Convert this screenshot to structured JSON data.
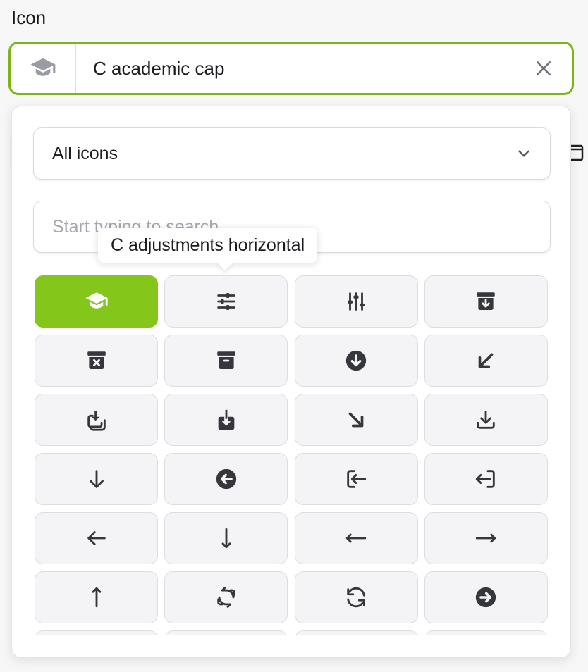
{
  "field": {
    "label": "Icon",
    "selected_value": "C academic cap",
    "selected_icon": "academic-cap-icon",
    "clear_icon": "close-icon"
  },
  "dropdown": {
    "category_select": {
      "value": "All icons",
      "icon": "chevron-down-icon"
    },
    "search": {
      "placeholder": "Start typing to search",
      "value": ""
    },
    "tooltip": "C adjustments horizontal"
  },
  "grid": {
    "selected_index": 0,
    "icons": [
      "academic-cap-icon",
      "adjustments-horizontal-icon",
      "adjustments-vertical-icon",
      "archive-box-arrow-down-icon",
      "archive-box-x-mark-icon",
      "archive-box-icon",
      "arrow-down-circle-icon",
      "arrow-down-left-icon",
      "arrow-down-on-square-stack-icon",
      "arrow-down-on-square-icon",
      "arrow-down-right-icon",
      "arrow-down-tray-icon",
      "arrow-down-icon",
      "arrow-left-circle-icon",
      "arrow-left-end-on-rectangle-icon",
      "arrow-left-start-on-rectangle-icon",
      "arrow-left-icon",
      "arrow-long-down-icon",
      "arrow-long-left-icon",
      "arrow-long-right-icon",
      "arrow-long-up-icon",
      "arrow-path-rounded-square-icon",
      "arrow-path-icon",
      "arrow-right-circle-icon",
      "more-icon",
      "more-icon",
      "more-icon",
      "more-icon"
    ]
  },
  "colors": {
    "accent": "#84c71a",
    "focus_border": "#7cb518"
  }
}
